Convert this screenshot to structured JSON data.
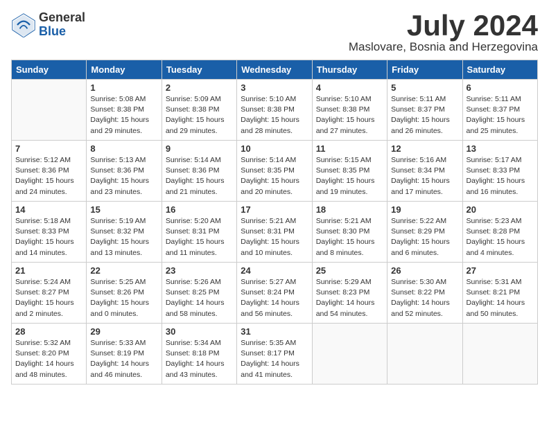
{
  "logo": {
    "general": "General",
    "blue": "Blue"
  },
  "title": {
    "month": "July 2024",
    "location": "Maslovare, Bosnia and Herzegovina"
  },
  "days_of_week": [
    "Sunday",
    "Monday",
    "Tuesday",
    "Wednesday",
    "Thursday",
    "Friday",
    "Saturday"
  ],
  "weeks": [
    [
      {
        "day": "",
        "info": ""
      },
      {
        "day": "1",
        "info": "Sunrise: 5:08 AM\nSunset: 8:38 PM\nDaylight: 15 hours\nand 29 minutes."
      },
      {
        "day": "2",
        "info": "Sunrise: 5:09 AM\nSunset: 8:38 PM\nDaylight: 15 hours\nand 29 minutes."
      },
      {
        "day": "3",
        "info": "Sunrise: 5:10 AM\nSunset: 8:38 PM\nDaylight: 15 hours\nand 28 minutes."
      },
      {
        "day": "4",
        "info": "Sunrise: 5:10 AM\nSunset: 8:38 PM\nDaylight: 15 hours\nand 27 minutes."
      },
      {
        "day": "5",
        "info": "Sunrise: 5:11 AM\nSunset: 8:37 PM\nDaylight: 15 hours\nand 26 minutes."
      },
      {
        "day": "6",
        "info": "Sunrise: 5:11 AM\nSunset: 8:37 PM\nDaylight: 15 hours\nand 25 minutes."
      }
    ],
    [
      {
        "day": "7",
        "info": "Sunrise: 5:12 AM\nSunset: 8:36 PM\nDaylight: 15 hours\nand 24 minutes."
      },
      {
        "day": "8",
        "info": "Sunrise: 5:13 AM\nSunset: 8:36 PM\nDaylight: 15 hours\nand 23 minutes."
      },
      {
        "day": "9",
        "info": "Sunrise: 5:14 AM\nSunset: 8:36 PM\nDaylight: 15 hours\nand 21 minutes."
      },
      {
        "day": "10",
        "info": "Sunrise: 5:14 AM\nSunset: 8:35 PM\nDaylight: 15 hours\nand 20 minutes."
      },
      {
        "day": "11",
        "info": "Sunrise: 5:15 AM\nSunset: 8:35 PM\nDaylight: 15 hours\nand 19 minutes."
      },
      {
        "day": "12",
        "info": "Sunrise: 5:16 AM\nSunset: 8:34 PM\nDaylight: 15 hours\nand 17 minutes."
      },
      {
        "day": "13",
        "info": "Sunrise: 5:17 AM\nSunset: 8:33 PM\nDaylight: 15 hours\nand 16 minutes."
      }
    ],
    [
      {
        "day": "14",
        "info": "Sunrise: 5:18 AM\nSunset: 8:33 PM\nDaylight: 15 hours\nand 14 minutes."
      },
      {
        "day": "15",
        "info": "Sunrise: 5:19 AM\nSunset: 8:32 PM\nDaylight: 15 hours\nand 13 minutes."
      },
      {
        "day": "16",
        "info": "Sunrise: 5:20 AM\nSunset: 8:31 PM\nDaylight: 15 hours\nand 11 minutes."
      },
      {
        "day": "17",
        "info": "Sunrise: 5:21 AM\nSunset: 8:31 PM\nDaylight: 15 hours\nand 10 minutes."
      },
      {
        "day": "18",
        "info": "Sunrise: 5:21 AM\nSunset: 8:30 PM\nDaylight: 15 hours\nand 8 minutes."
      },
      {
        "day": "19",
        "info": "Sunrise: 5:22 AM\nSunset: 8:29 PM\nDaylight: 15 hours\nand 6 minutes."
      },
      {
        "day": "20",
        "info": "Sunrise: 5:23 AM\nSunset: 8:28 PM\nDaylight: 15 hours\nand 4 minutes."
      }
    ],
    [
      {
        "day": "21",
        "info": "Sunrise: 5:24 AM\nSunset: 8:27 PM\nDaylight: 15 hours\nand 2 minutes."
      },
      {
        "day": "22",
        "info": "Sunrise: 5:25 AM\nSunset: 8:26 PM\nDaylight: 15 hours\nand 0 minutes."
      },
      {
        "day": "23",
        "info": "Sunrise: 5:26 AM\nSunset: 8:25 PM\nDaylight: 14 hours\nand 58 minutes."
      },
      {
        "day": "24",
        "info": "Sunrise: 5:27 AM\nSunset: 8:24 PM\nDaylight: 14 hours\nand 56 minutes."
      },
      {
        "day": "25",
        "info": "Sunrise: 5:29 AM\nSunset: 8:23 PM\nDaylight: 14 hours\nand 54 minutes."
      },
      {
        "day": "26",
        "info": "Sunrise: 5:30 AM\nSunset: 8:22 PM\nDaylight: 14 hours\nand 52 minutes."
      },
      {
        "day": "27",
        "info": "Sunrise: 5:31 AM\nSunset: 8:21 PM\nDaylight: 14 hours\nand 50 minutes."
      }
    ],
    [
      {
        "day": "28",
        "info": "Sunrise: 5:32 AM\nSunset: 8:20 PM\nDaylight: 14 hours\nand 48 minutes."
      },
      {
        "day": "29",
        "info": "Sunrise: 5:33 AM\nSunset: 8:19 PM\nDaylight: 14 hours\nand 46 minutes."
      },
      {
        "day": "30",
        "info": "Sunrise: 5:34 AM\nSunset: 8:18 PM\nDaylight: 14 hours\nand 43 minutes."
      },
      {
        "day": "31",
        "info": "Sunrise: 5:35 AM\nSunset: 8:17 PM\nDaylight: 14 hours\nand 41 minutes."
      },
      {
        "day": "",
        "info": ""
      },
      {
        "day": "",
        "info": ""
      },
      {
        "day": "",
        "info": ""
      }
    ]
  ]
}
